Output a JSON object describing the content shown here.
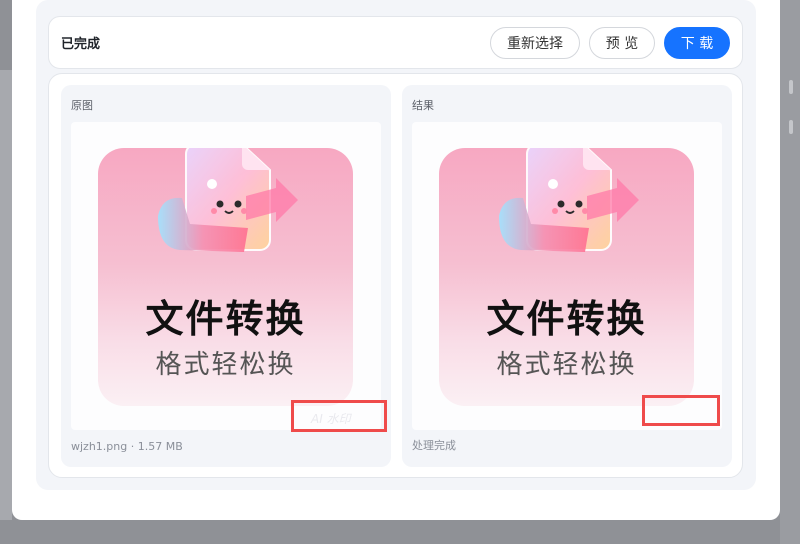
{
  "status": {
    "text": "已完成"
  },
  "actions": {
    "reselect": "重新选择",
    "preview": "预 览",
    "download": "下 载"
  },
  "original": {
    "label": "原图",
    "footer": "wjzh1.png · 1.57 MB",
    "watermark_text": "AI 水印"
  },
  "result": {
    "label": "结果",
    "footer": "处理完成"
  },
  "artwork": {
    "title": "文件转换",
    "subtitle": "格式轻松换"
  },
  "colors": {
    "accent": "#1673ff",
    "highlight": "#ef4b4b"
  }
}
